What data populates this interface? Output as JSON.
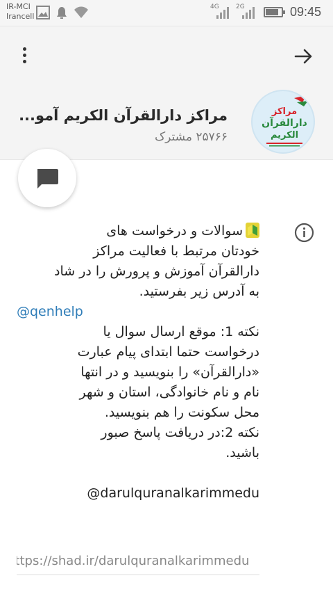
{
  "status_bar": {
    "carrier_line1": "IR-MCI",
    "carrier_line2": "Irancell",
    "network1": "4G",
    "network2": "2G",
    "battery_level": 0.8,
    "time": "09:45"
  },
  "toolbar": {
    "menu_icon": "more-vertical-icon",
    "back_icon": "arrow-right-icon"
  },
  "channel": {
    "title": "مراکز دارالقرآن الکریم آمو...",
    "subscribers": "۲۵۷۶۶ مشترک",
    "avatar_text": {
      "line1": "مراکز",
      "line2": "دارالقرآن",
      "line3": "الکریم"
    }
  },
  "fab": {
    "icon": "chat-bubble-icon"
  },
  "info": {
    "icon": "info-icon",
    "paragraph1_lines": [
      "سوالات و درخواست های",
      "خودتان مرتبط با فعالیت مراکز",
      "دارالقرآن آموزش و پرورش را در شاد",
      "به آدرس زیر بفرستید."
    ],
    "help_handle": "@qenhelp",
    "note_lines": [
      "نکته 1: موقع ارسال سوال یا",
      "درخواست حتما ابتدای پیام عبارت",
      "«دارالقرآن» را بنویسید و در انتها",
      "نام و نام خانوادگی، استان و شهر",
      "محل سکونت را هم بنویسید.",
      "نکته 2:در دریافت پاسخ صبور",
      "باشید."
    ],
    "channel_handle": "@darulquranalkarimmedu",
    "channel_url": "https://shad.ir/darulquranalkarimmedu"
  },
  "colors": {
    "link": "#2f7db8",
    "header_bg": "#f4f4f4",
    "avatar_bg": "#ddeef8",
    "avatar_red": "#d8232a",
    "avatar_green": "#2a8a3e"
  }
}
